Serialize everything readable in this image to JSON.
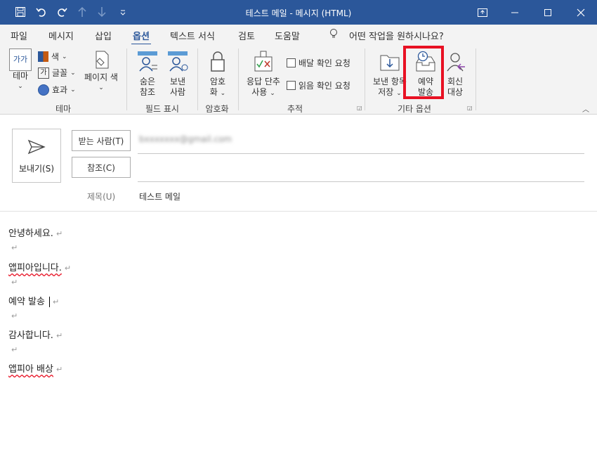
{
  "window": {
    "title": "테스트 메일  -  메시지 (HTML)"
  },
  "menubar": {
    "items": [
      "파일",
      "메시지",
      "삽입",
      "옵션",
      "텍스트 서식",
      "검토",
      "도움말"
    ],
    "active": "옵션",
    "search_placeholder": "어떤 작업을 원하시나요?"
  },
  "ribbon": {
    "theme": {
      "button_label": "테마",
      "color": "색",
      "font": "글꼴",
      "effects": "효과",
      "page_color": "페이지 색",
      "group": "테마"
    },
    "fields": {
      "bcc_line1": "숨은",
      "bcc_line2": "참조",
      "from_line1": "보낸",
      "from_line2": "사람",
      "group": "필드 표시"
    },
    "encrypt": {
      "line1": "암호",
      "line2": "화",
      "group": "암호화"
    },
    "tracking": {
      "voting_line1": "응답 단추",
      "voting_line2": "사용",
      "delivery": "배달 확인 요청",
      "read": "읽음 확인 요청",
      "group": "추적"
    },
    "more": {
      "save_line1": "보낸 항목",
      "save_line2": "저장",
      "delay_line1": "예약",
      "delay_line2": "발송",
      "reply_line1": "회신",
      "reply_line2": "대상",
      "group": "기타 옵션"
    }
  },
  "compose": {
    "send_label": "보내기(S)",
    "to_button": "받는 사람(T)",
    "to_value": "bxxxxxxx@gmail.com",
    "cc_button": "참조(C)",
    "subject_label": "제목(U)",
    "subject_value": "테스트 메일"
  },
  "body_lines": [
    "안녕하세요.",
    "",
    "앱피아입니다.",
    "",
    "예약 발송",
    "",
    "감사합니다.",
    "",
    "앱피아 배상"
  ],
  "pilcrow": "↵",
  "colors": {
    "accent": "#2b579a",
    "highlight": "#e81123"
  }
}
